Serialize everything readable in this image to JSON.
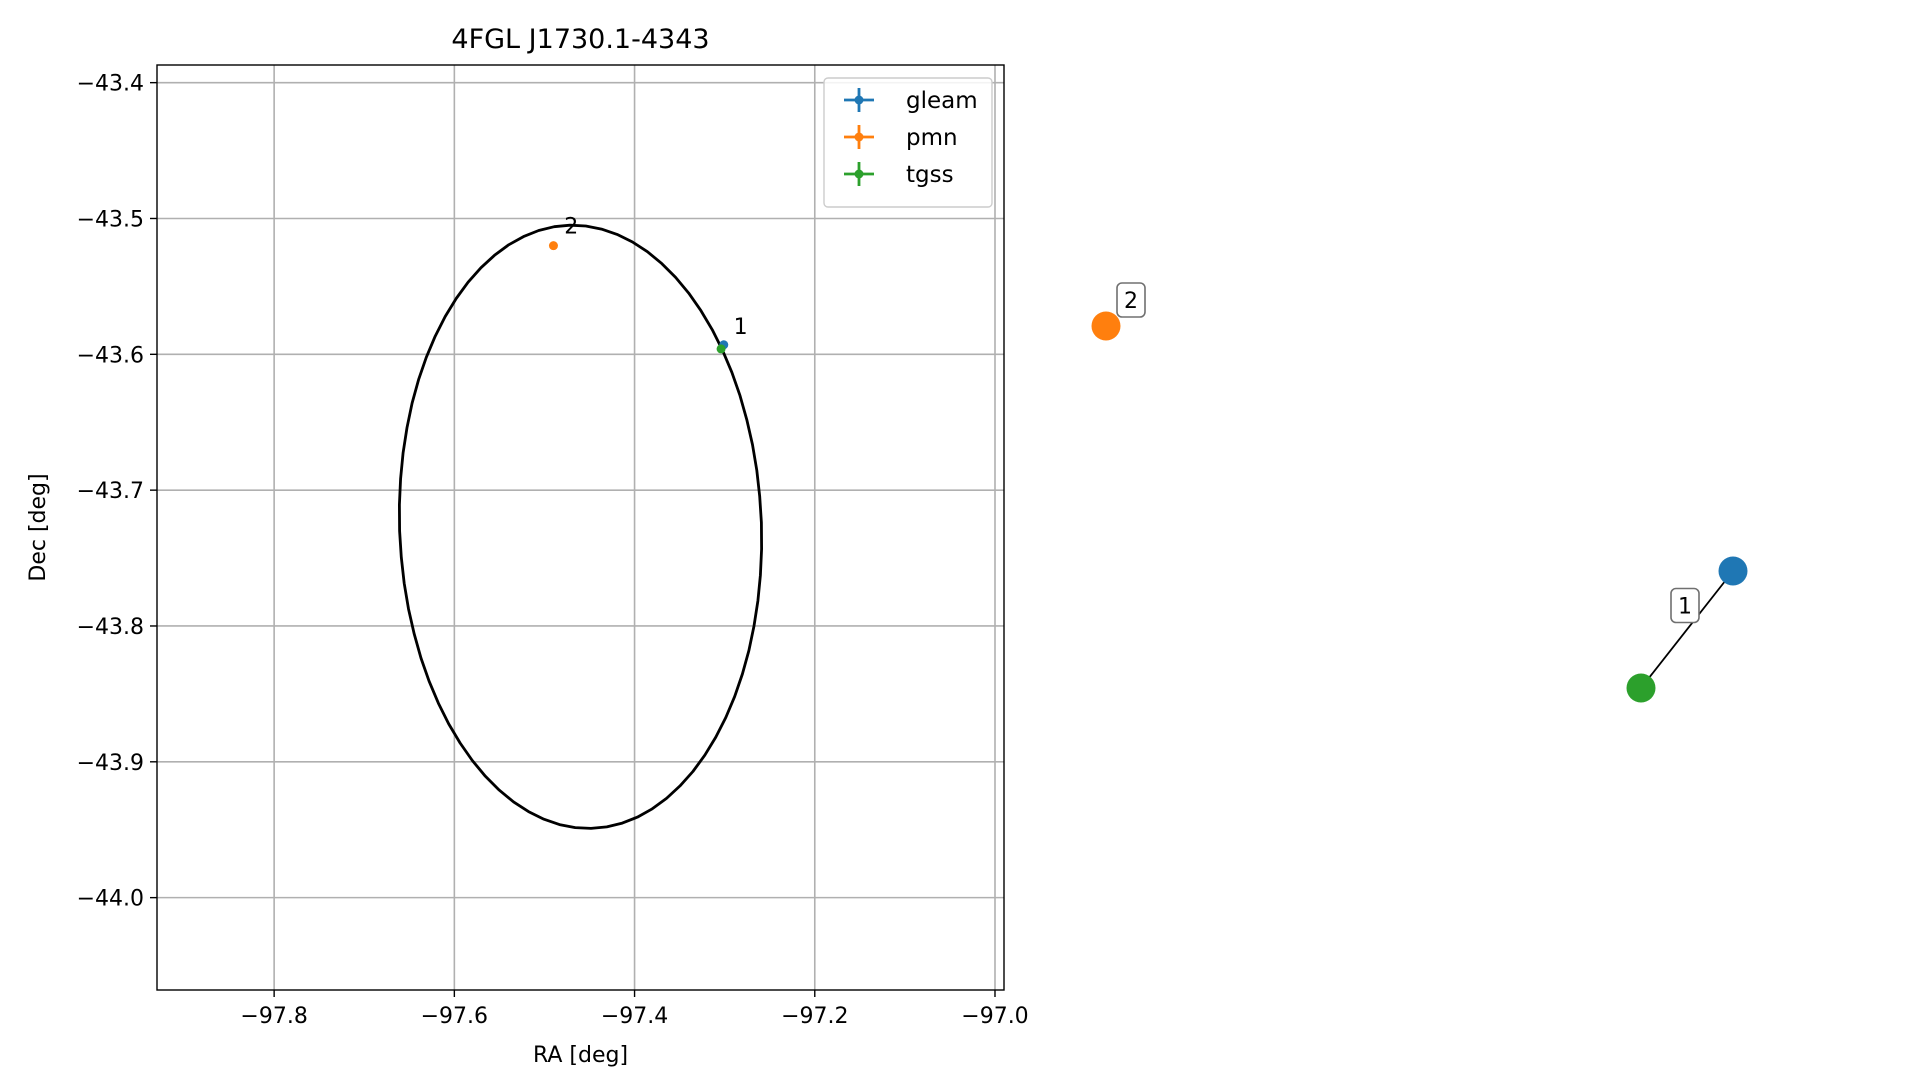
{
  "chart_data": [
    {
      "type": "scatter",
      "title": "4FGL J1730.1-4343",
      "xlabel": "RA [deg]",
      "ylabel": "Dec [deg]",
      "xlim": [
        -97.93,
        -96.99
      ],
      "ylim": [
        -44.068,
        -43.387
      ],
      "xticks": [
        -97.8,
        -97.6,
        -97.4,
        -97.2,
        -97.0
      ],
      "xtick_labels": [
        "−97.8",
        "−97.6",
        "−97.4",
        "−97.2",
        "−97.0"
      ],
      "yticks": [
        -43.4,
        -43.5,
        -43.6,
        -43.7,
        -43.8,
        -43.9,
        -44.0
      ],
      "ytick_labels": [
        "−43.4",
        "−43.5",
        "−43.6",
        "−43.7",
        "−43.8",
        "−43.9",
        "−44.0"
      ],
      "grid": true,
      "legend_position": "top-right",
      "series": [
        {
          "name": "gleam",
          "color": "#1f77b4",
          "points": [
            {
              "x": -97.301,
              "y": -43.593
            }
          ]
        },
        {
          "name": "pmn",
          "color": "#ff7f0e",
          "points": [
            {
              "x": -97.49,
              "y": -43.52
            }
          ]
        },
        {
          "name": "tgss",
          "color": "#2ca02c",
          "points": [
            {
              "x": -97.304,
              "y": -43.596
            }
          ]
        }
      ],
      "annotations": [
        {
          "text": "1",
          "x": -97.29,
          "y": -43.585
        },
        {
          "text": "2",
          "x": -97.478,
          "y": -43.511
        }
      ],
      "ellipse": {
        "color": "#000000",
        "center_x": -97.46,
        "center_y": -43.727,
        "semi_axis_ra": 0.2,
        "semi_axis_dec": 0.223,
        "rotation_deg": 12
      }
    },
    {
      "type": "network",
      "nodes": [
        {
          "id": "gleam",
          "color": "#1f77b4"
        },
        {
          "id": "pmn",
          "color": "#ff7f0e"
        },
        {
          "id": "tgss",
          "color": "#2ca02c"
        }
      ],
      "edges": [
        {
          "source": "gleam",
          "target": "tgss",
          "label": "1"
        }
      ],
      "group_labels": [
        {
          "text": "2",
          "near": "pmn"
        }
      ]
    }
  ]
}
